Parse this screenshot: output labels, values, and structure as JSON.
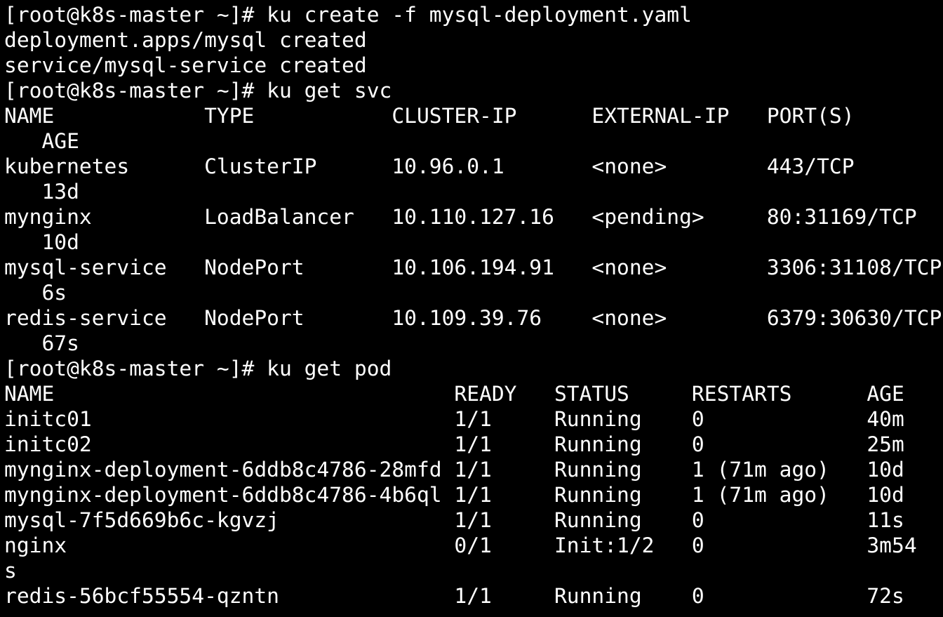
{
  "terminal": {
    "lines": [
      "[root@k8s-master ~]# ku create -f mysql-deployment.yaml",
      "deployment.apps/mysql created",
      "service/mysql-service created",
      "[root@k8s-master ~]# ku get svc",
      "NAME            TYPE           CLUSTER-IP      EXTERNAL-IP   PORT(S)",
      "   AGE",
      "kubernetes      ClusterIP      10.96.0.1       <none>        443/TCP",
      "   13d",
      "mynginx         LoadBalancer   10.110.127.16   <pending>     80:31169/TCP",
      "   10d",
      "mysql-service   NodePort       10.106.194.91   <none>        3306:31108/TCP",
      "   6s",
      "redis-service   NodePort       10.109.39.76    <none>        6379:30630/TCP",
      "   67s",
      "[root@k8s-master ~]# ku get pod",
      "NAME                                READY   STATUS     RESTARTS      AGE",
      "initc01                             1/1     Running    0             40m",
      "initc02                             1/1     Running    0             25m",
      "mynginx-deployment-6ddb8c4786-28mfd 1/1     Running    1 (71m ago)   10d",
      "mynginx-deployment-6ddb8c4786-4b6ql 1/1     Running    1 (71m ago)   10d",
      "mysql-7f5d669b6c-kgvzj              1/1     Running    0             11s",
      "nginx                               0/1     Init:1/2   0             3m54",
      "s",
      "redis-56bcf55554-qzntn              1/1     Running    0             72s"
    ]
  },
  "colors": {
    "background": "#000000",
    "foreground": "#ffffff"
  }
}
